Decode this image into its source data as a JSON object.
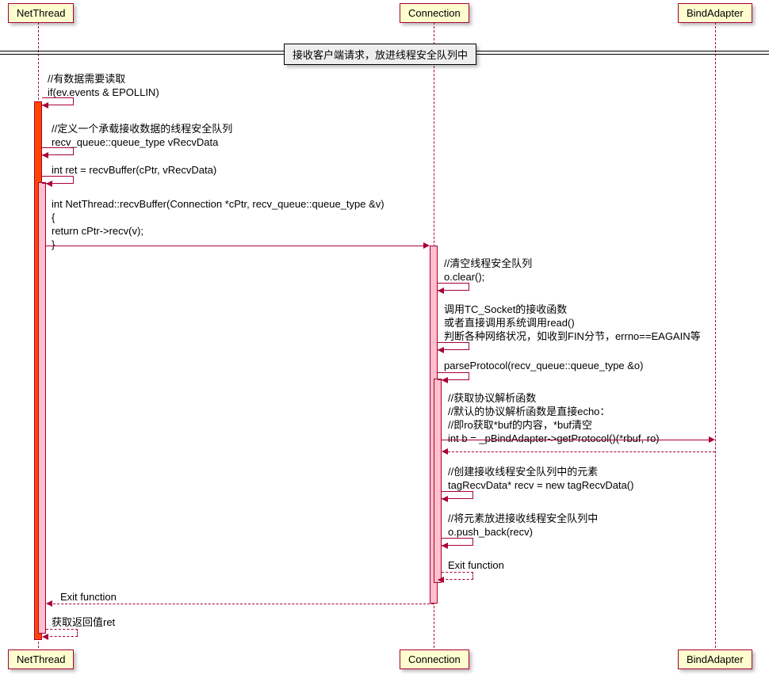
{
  "participants": {
    "net_thread": "NetThread",
    "connection": "Connection",
    "bind_adapter": "BindAdapter"
  },
  "divider_title": "接收客户端请求，放进线程安全队列中",
  "msg1_l1": "//有数据需要读取",
  "msg1_l2": "if(ev.events & EPOLLIN)",
  "msg2_l1": "//定义一个承载接收数据的线程安全队列",
  "msg2_l2": "recv_queue::queue_type vRecvData",
  "msg3": "int ret = recvBuffer(cPtr, vRecvData)",
  "msg4_l1": "int NetThread::recvBuffer(Connection *cPtr, recv_queue::queue_type &v)",
  "msg4_l2": "{",
  "msg4_l3": "    return cPtr->recv(v);",
  "msg4_l4": "}",
  "msg5_l1": "//清空线程安全队列",
  "msg5_l2": "o.clear();",
  "msg6_l1": "调用TC_Socket的接收函数",
  "msg6_l2": "或者直接调用系统调用read()",
  "msg6_l3": "判断各种网络状况，如收到FIN分节，errno==EAGAIN等",
  "msg7": "parseProtocol(recv_queue::queue_type &o)",
  "msg8_l1": "//获取协议解析函数",
  "msg8_l2": "//默认的协议解析函数是直接echo：",
  "msg8_l3": "//即ro获取*buf的内容，*buf清空",
  "msg8_l4": "int b = _pBindAdapter->getProtocol()(*rbuf, ro)",
  "msg9_l1": "//创建接收线程安全队列中的元素",
  "msg9_l2": "tagRecvData* recv = new tagRecvData()",
  "msg10_l1": "//将元素放进接收线程安全队列中",
  "msg10_l2": "o.push_back(recv)",
  "msg11": "Exit function",
  "msg12": "Exit function",
  "msg13": "获取返回值ret",
  "chart_data": {
    "type": "sequence-diagram",
    "participants": [
      "NetThread",
      "Connection",
      "BindAdapter"
    ],
    "divider": "接收客户端请求，放进线程安全队列中",
    "messages": [
      {
        "from": "NetThread",
        "to": "NetThread",
        "text": "//有数据需要读取 if(ev.events & EPOLLIN)",
        "activate": "NetThread"
      },
      {
        "from": "NetThread",
        "to": "NetThread",
        "text": "//定义一个承载接收数据的线程安全队列 recv_queue::queue_type vRecvData"
      },
      {
        "from": "NetThread",
        "to": "NetThread",
        "text": "int ret = recvBuffer(cPtr, vRecvData)",
        "activate_nested": "NetThread"
      },
      {
        "from": "NetThread",
        "to": "Connection",
        "text": "int NetThread::recvBuffer(Connection *cPtr, recv_queue::queue_type &v) { return cPtr->recv(v); }",
        "activate": "Connection"
      },
      {
        "from": "Connection",
        "to": "Connection",
        "text": "//清空线程安全队列 o.clear();"
      },
      {
        "from": "Connection",
        "to": "Connection",
        "text": "调用TC_Socket的接收函数 或者直接调用系统调用read() 判断各种网络状况，如收到FIN分节，errno==EAGAIN等"
      },
      {
        "from": "Connection",
        "to": "Connection",
        "text": "parseProtocol(recv_queue::queue_type &o)",
        "activate_nested": "Connection"
      },
      {
        "from": "Connection",
        "to": "BindAdapter",
        "text": "//获取协议解析函数 //默认的协议解析函数是直接echo：//即ro获取*buf的内容，*buf清空 int b = _pBindAdapter->getProtocol()(*rbuf, ro)"
      },
      {
        "from": "BindAdapter",
        "to": "Connection",
        "style": "dashed"
      },
      {
        "from": "Connection",
        "to": "Connection",
        "text": "//创建接收线程安全队列中的元素 tagRecvData* recv = new tagRecvData()"
      },
      {
        "from": "Connection",
        "to": "Connection",
        "text": "//将元素放进接收线程安全队列中 o.push_back(recv)"
      },
      {
        "from": "Connection",
        "to": "Connection",
        "text": "Exit function",
        "style": "dashed",
        "deactivate_nested": "Connection"
      },
      {
        "from": "Connection",
        "to": "NetThread",
        "text": "Exit function",
        "style": "dashed",
        "deactivate": "Connection"
      },
      {
        "from": "NetThread",
        "to": "NetThread",
        "text": "获取返回值ret",
        "style": "dashed",
        "deactivate_nested": "NetThread"
      }
    ]
  }
}
